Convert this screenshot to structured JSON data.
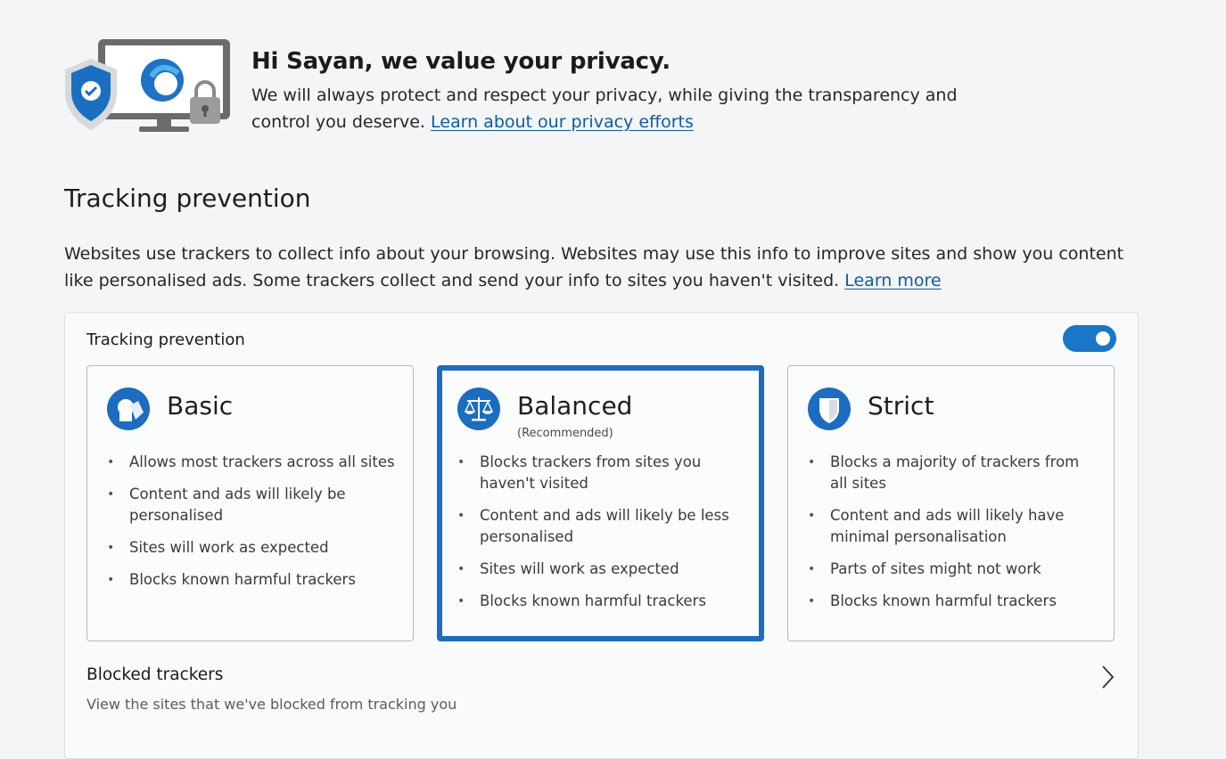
{
  "header": {
    "title": "Hi Sayan, we value your privacy.",
    "description": "We will always protect and respect your privacy, while giving the transparency and control you deserve.",
    "link": "Learn about our privacy efforts",
    "illustration": "privacy-shield-monitor-lock-icon"
  },
  "tracking": {
    "section_title": "Tracking prevention",
    "description": "Websites use trackers to collect info about your browsing. Websites may use this info to improve sites and show you content like personalised ads. Some trackers collect and send your info to sites you haven't visited.",
    "learn_more": "Learn more",
    "card_title": "Tracking prevention",
    "toggle_on": true,
    "accent_color": "#1a6dc0",
    "options": [
      {
        "name": "Basic",
        "subtitle": "",
        "icon": "basic-shapes-icon",
        "selected": false,
        "bullets": [
          "Allows most trackers across all sites",
          "Content and ads will likely be personalised",
          "Sites will work as expected",
          "Blocks known harmful trackers"
        ]
      },
      {
        "name": "Balanced",
        "subtitle": "(Recommended)",
        "icon": "balance-scale-icon",
        "selected": true,
        "bullets": [
          "Blocks trackers from sites you haven't visited",
          "Content and ads will likely be less personalised",
          "Sites will work as expected",
          "Blocks known harmful trackers"
        ]
      },
      {
        "name": "Strict",
        "subtitle": "",
        "icon": "shield-icon",
        "selected": false,
        "bullets": [
          "Blocks a majority of trackers from all sites",
          "Content and ads will likely have minimal personalisation",
          "Parts of sites might not work",
          "Blocks known harmful trackers"
        ]
      }
    ],
    "blocked": {
      "title": "Blocked trackers",
      "description": "View the sites that we've blocked from tracking you"
    }
  }
}
